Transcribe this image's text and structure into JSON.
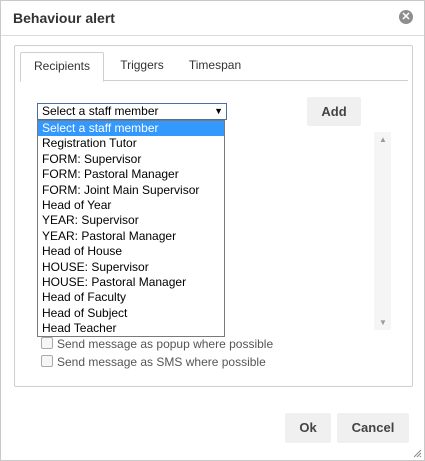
{
  "dialog": {
    "title": "Behaviour alert",
    "close_icon": "close-icon"
  },
  "tabs": [
    {
      "label": "Recipients",
      "active": true
    },
    {
      "label": "Triggers",
      "active": false
    },
    {
      "label": "Timespan",
      "active": false
    }
  ],
  "staff_select": {
    "value": "Select a staff member",
    "options": [
      "Select a staff member",
      "Registration Tutor",
      "FORM: Supervisor",
      "FORM: Pastoral Manager",
      "FORM: Joint Main Supervisor",
      "Head of Year",
      "YEAR: Supervisor",
      "YEAR: Pastoral Manager",
      "Head of House",
      "HOUSE: Supervisor",
      "HOUSE: Pastoral Manager",
      "Head of Faculty",
      "Head of Subject",
      "Head Teacher"
    ],
    "highlighted_index": 0
  },
  "add_button": "Add",
  "options": {
    "popup_label": "Send message as popup where possible",
    "sms_label": "Send message as SMS where possible"
  },
  "footer": {
    "ok_label": "Ok",
    "cancel_label": "Cancel"
  },
  "colors": {
    "highlight": "#3399ff",
    "button_bg": "#f0f0f0"
  }
}
